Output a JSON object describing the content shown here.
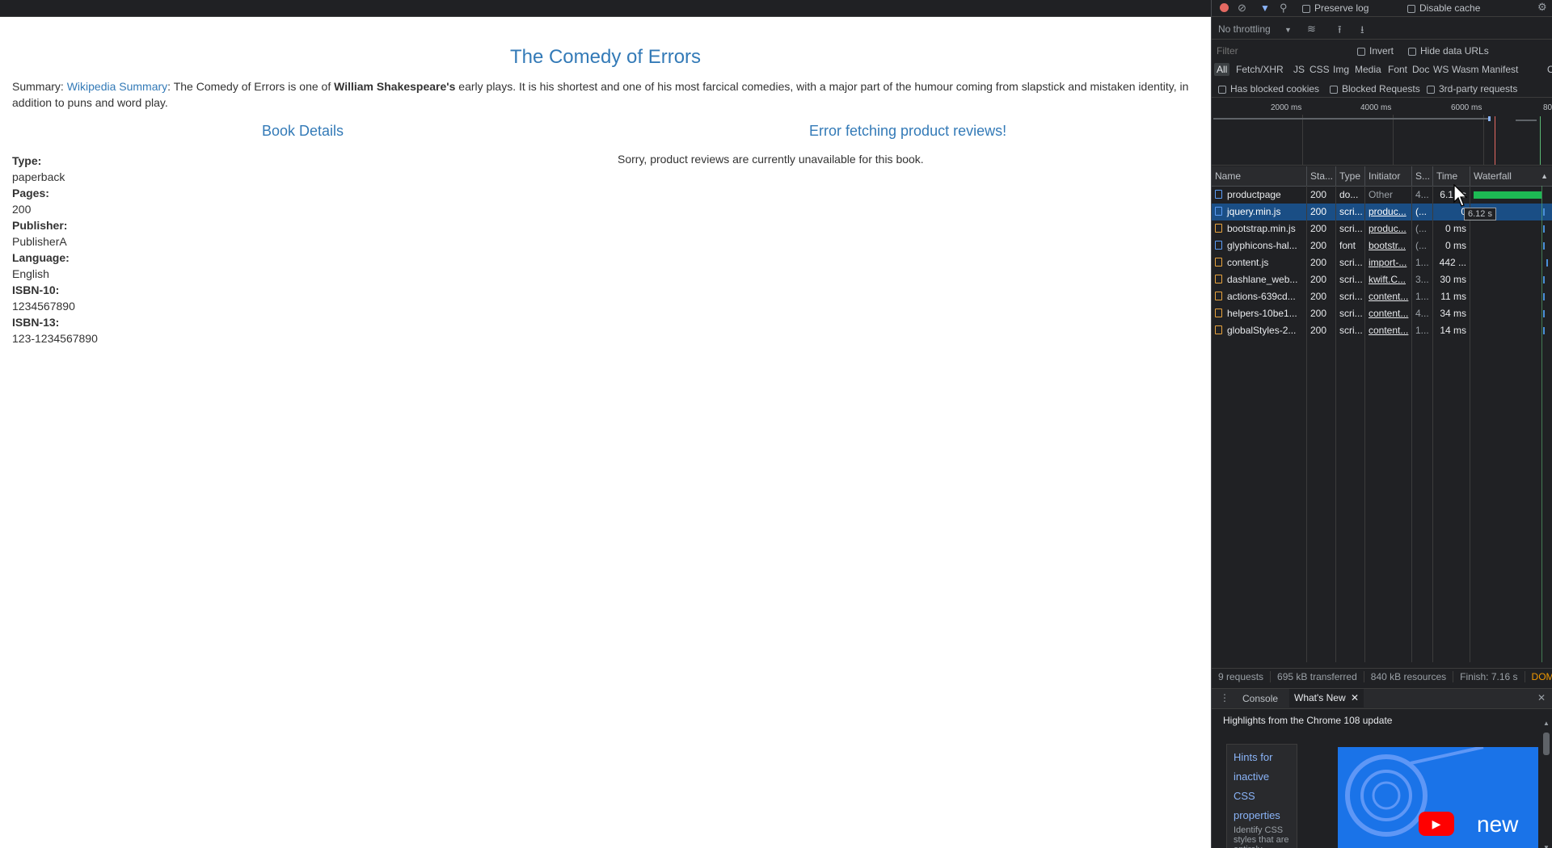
{
  "page": {
    "title": "The Comedy of Errors",
    "summary_prefix": "Summary: ",
    "summary_link": "Wikipedia Summary",
    "summary_text1": ": The Comedy of Errors is one of ",
    "summary_bold": "William Shakespeare's",
    "summary_text2": " early plays. It is his shortest and one of his most farcical comedies, with a major part of the humour coming from slapstick and mistaken identity, in addition to puns and word play.",
    "details_heading": "Book Details",
    "reviews_heading": "Error fetching product reviews!",
    "reviews_message": "Sorry, product reviews are currently unavailable for this book.",
    "details": [
      {
        "key": "Type:",
        "value": "paperback"
      },
      {
        "key": "Pages:",
        "value": "200"
      },
      {
        "key": "Publisher:",
        "value": "PublisherA"
      },
      {
        "key": "Language:",
        "value": "English"
      },
      {
        "key": "ISBN-10:",
        "value": "1234567890"
      },
      {
        "key": "ISBN-13:",
        "value": "123-1234567890"
      }
    ]
  },
  "devtools": {
    "preserve_log": "Preserve log",
    "disable_cache": "Disable cache",
    "throttling": "No throttling",
    "filter_placeholder": "Filter",
    "invert": "Invert",
    "hide_data_urls": "Hide data URLs",
    "types": [
      "All",
      "Fetch/XHR",
      "JS",
      "CSS",
      "Img",
      "Media",
      "Font",
      "Doc",
      "WS",
      "Wasm",
      "Manifest",
      "O"
    ],
    "has_blocked_cookies": "Has blocked cookies",
    "blocked_requests": "Blocked Requests",
    "third_party": "3rd-party requests",
    "ticks": [
      "2000 ms",
      "4000 ms",
      "6000 ms",
      "80"
    ],
    "columns": [
      "Name",
      "Sta...",
      "Type",
      "Initiator",
      "S...",
      "Time",
      "Waterfall"
    ],
    "rows": [
      {
        "name": "productpage",
        "status": "200",
        "type": "do...",
        "initiator": "Other",
        "size": "4...",
        "time": "6.12 s",
        "icon": "doc"
      },
      {
        "name": "jquery.min.js",
        "status": "200",
        "type": "scri...",
        "initiator": "produc...",
        "size": "(...",
        "time": "0",
        "icon": "doc"
      },
      {
        "name": "bootstrap.min.js",
        "status": "200",
        "type": "scri...",
        "initiator": "produc...",
        "size": "(...",
        "time": "0 ms",
        "icon": "js"
      },
      {
        "name": "glyphicons-hal...",
        "status": "200",
        "type": "font",
        "initiator": "bootstr...",
        "size": "(...",
        "time": "0 ms",
        "icon": "font"
      },
      {
        "name": "content.js",
        "status": "200",
        "type": "scri...",
        "initiator": "import-...",
        "size": "1...",
        "time": "442 ...",
        "icon": "js"
      },
      {
        "name": "dashlane_web...",
        "status": "200",
        "type": "scri...",
        "initiator": "kwift.C...",
        "size": "3...",
        "time": "30 ms",
        "icon": "js"
      },
      {
        "name": "actions-639cd...",
        "status": "200",
        "type": "scri...",
        "initiator": "content...",
        "size": "1...",
        "time": "11 ms",
        "icon": "js"
      },
      {
        "name": "helpers-10be1...",
        "status": "200",
        "type": "scri...",
        "initiator": "content...",
        "size": "4...",
        "time": "34 ms",
        "icon": "js"
      },
      {
        "name": "globalStyles-2...",
        "status": "200",
        "type": "scri...",
        "initiator": "content...",
        "size": "1...",
        "time": "14 ms",
        "icon": "js"
      }
    ],
    "tooltip": "6.12 s",
    "status": {
      "requests": "9 requests",
      "transferred": "695 kB transferred",
      "resources": "840 kB resources",
      "finish": "Finish: 7.16 s",
      "dom": "DOM"
    },
    "drawer_tabs": [
      "Console",
      "What's New"
    ],
    "drawer_title": "Highlights from the Chrome 108 update",
    "drawer_card_title": "Hints for inactive CSS properties",
    "drawer_card_text": "Identify CSS styles that are entirely",
    "drawer_video_text": "new",
    "accent": "#1a4e85"
  }
}
